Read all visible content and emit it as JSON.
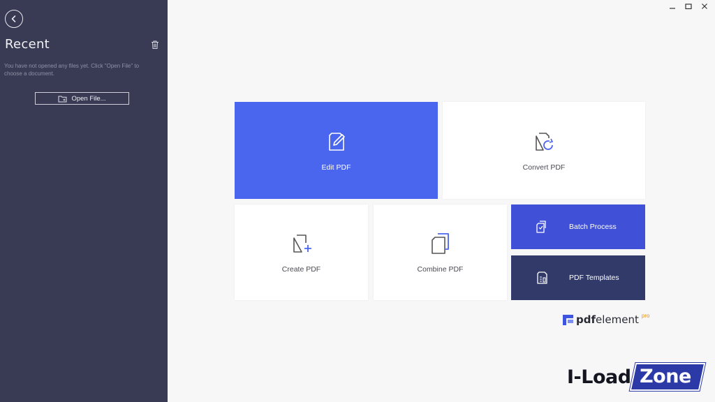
{
  "sidebar": {
    "title": "Recent",
    "empty_message": "You have not opened any files yet. Click \"Open File\" to choose a document.",
    "open_file_label": "Open File..."
  },
  "tiles": {
    "edit_pdf": "Edit PDF",
    "convert_pdf": "Convert PDF",
    "create_pdf": "Create PDF",
    "combine_pdf": "Combine PDF",
    "batch_process": "Batch Process",
    "pdf_templates": "PDF Templates"
  },
  "branding": {
    "logo_prefix": "pdf",
    "logo_suffix": "element",
    "logo_badge": "pro",
    "watermark_left": "I-Load",
    "watermark_right": "Zone"
  },
  "colors": {
    "sidebar": "#393b54",
    "edit_tile": "#4a65ee",
    "batch_tile": "#4051d8",
    "templates_tile": "#323a69",
    "logo_accent": "#e8941d"
  }
}
